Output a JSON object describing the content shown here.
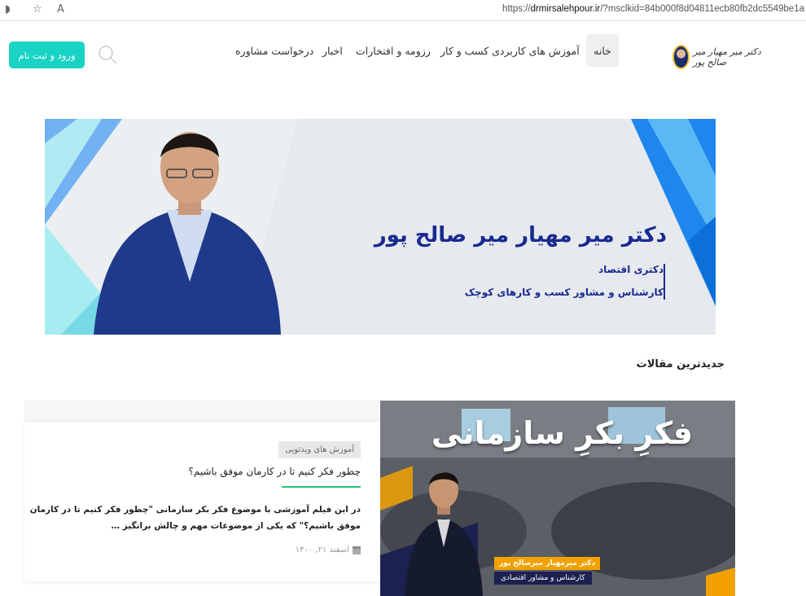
{
  "browser": {
    "url_prefix": "https://",
    "url_domain": "drmirsalehpour.ir",
    "url_rest": "/?msclkid=84b000f8d04811ecb80fb2dc5549be1a"
  },
  "header": {
    "logo_text": "دکتر میر مهیار میر صالح پور",
    "nav": {
      "home": "خانه",
      "business_training": "آموزش های کاربردی کسب و کار",
      "resume": "رزومه و افتخارات",
      "news": "اخبار",
      "consult": "درخواست مشاوره"
    },
    "login_label": "ورود و ثبت نام"
  },
  "hero": {
    "title": "دکتر میر مهیار میر صالح پور",
    "line1": "دکتری اقتصاد",
    "line2": "کارشناس و مشاور کسب و کارهای کوچک"
  },
  "latest": {
    "section_title": "جدیدترین مقالات",
    "article": {
      "category": "آموزش های ویدئویی",
      "title": "چطور فکر کنیم تا در کارمان موفق باشیم؟",
      "excerpt": "در این فیلم آموزشی با موضوع فکر بکر سازمانی \"چطور فکر کنیم تا در کارمان موفق باشیم؟\" که یکی از موضوعات مهم و چالش برانگیز …",
      "date": "اسفند ۲۱, ۱۴۰۰",
      "thumb_title": "فکرِ بکرِ سازمانی",
      "thumb_name": "دکتر میرمهیار میرصالح پور",
      "thumb_role": "کارشناس و مشاور اقتصادی"
    }
  },
  "colors": {
    "accent": "#19d3c5",
    "hero_text": "#1b2a8f",
    "underline": "#27c47a"
  }
}
